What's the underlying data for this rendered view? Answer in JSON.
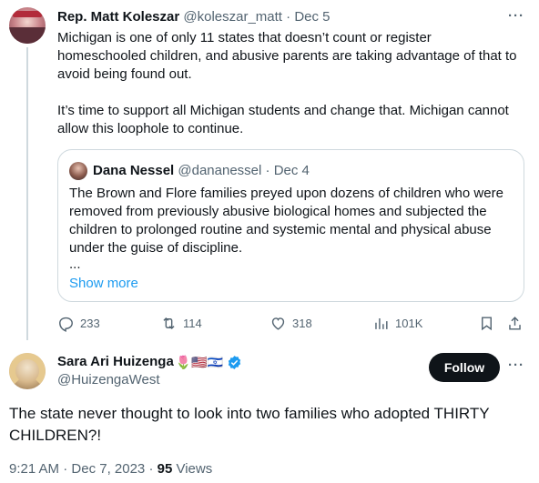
{
  "first_tweet": {
    "author_name": "Rep. Matt Koleszar",
    "author_handle": "@koleszar_matt",
    "separator": "·",
    "date": "Dec 5",
    "paragraph_1": "Michigan is one of only 11 states that doesn’t count or register homeschooled children, and abusive parents are taking advantage of that to avoid being found out.",
    "paragraph_2": "It’s time to support all Michigan students and change that.  Michigan cannot allow this loophole to continue.",
    "more_icon": "more-horizontal-icon",
    "quote": {
      "author_name": "Dana Nessel",
      "author_handle": "@dananessel",
      "separator": "·",
      "date": "Dec 4",
      "text": "The Brown and Flore families preyed upon dozens of children who were removed from previously abusive biological homes and subjected the children to prolonged routine and systemic mental and physical abuse under the guise of discipline.",
      "ellipsis": "...",
      "show_more": "Show more"
    },
    "actions": {
      "replies": "233",
      "retweets": "114",
      "likes": "318",
      "views": "101K"
    }
  },
  "second_tweet": {
    "author_name": "Sara Ari Huizenga",
    "name_emojis": "🌷🇺🇸🇮🇱",
    "author_handle": "@HuizengaWest",
    "follow_label": "Follow",
    "text": "The state never thought to look into two families who adopted THIRTY CHILDREN?!",
    "time": "9:21 AM",
    "separator": "·",
    "date": "Dec 7, 2023",
    "separator2": "·",
    "views_count": "95",
    "views_label": "Views"
  },
  "colors": {
    "text": "#0f1419",
    "muted": "#536471",
    "link": "#1d9bf0",
    "border": "#cfd9de",
    "verified": "#1d9bf0"
  }
}
